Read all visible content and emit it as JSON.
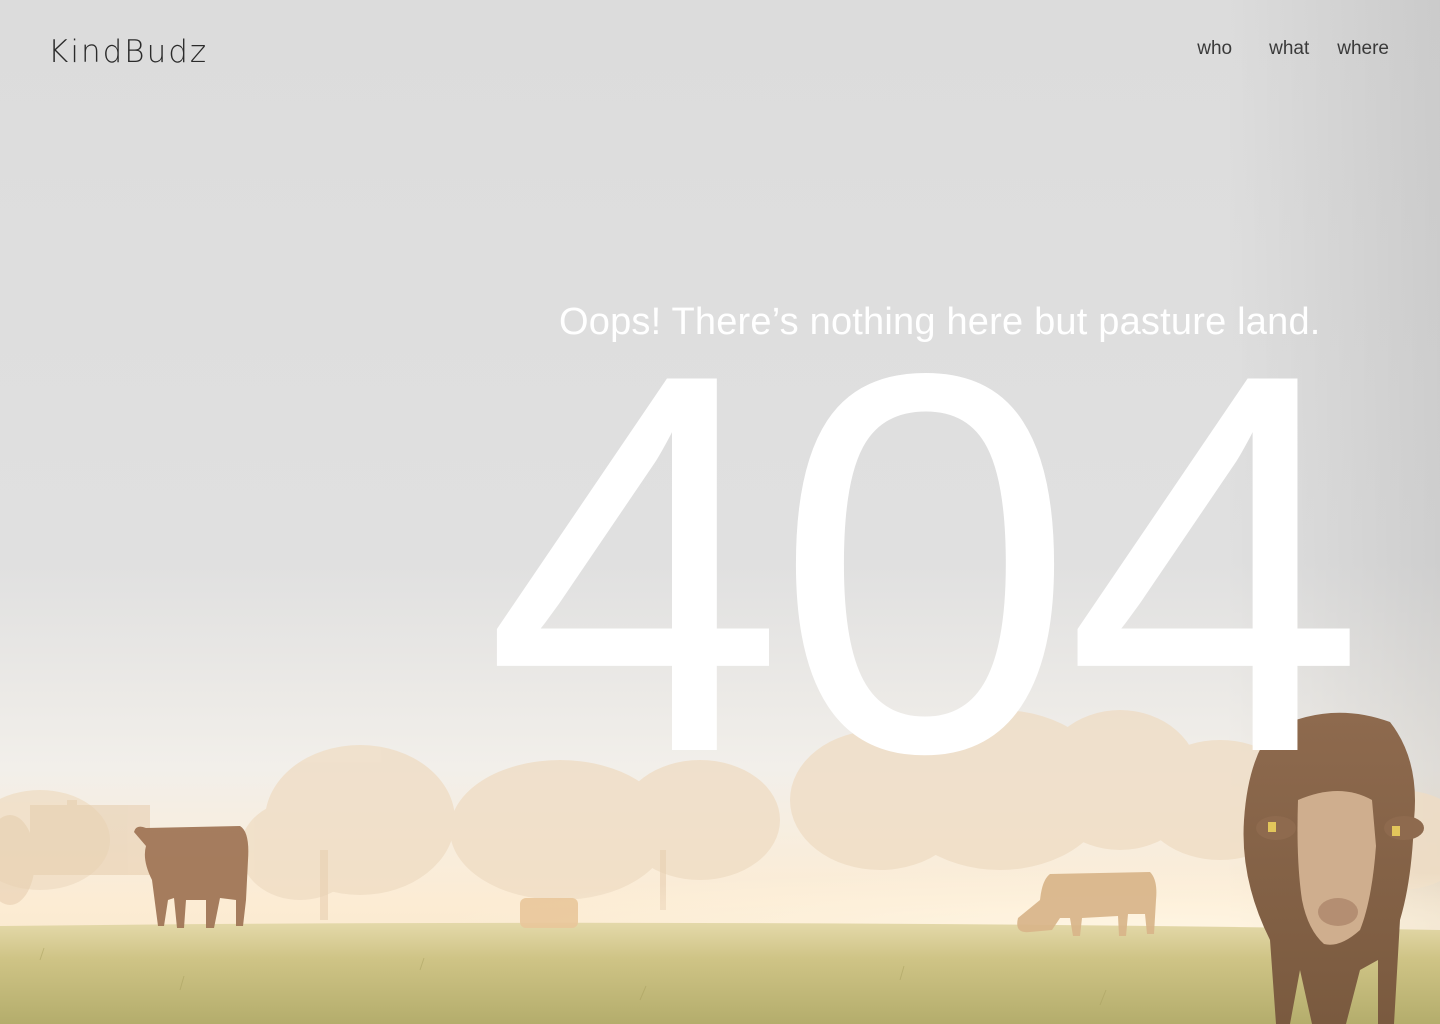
{
  "header": {
    "logo": "KindBudz",
    "nav": [
      {
        "label": "who"
      },
      {
        "label": "what"
      },
      {
        "label": "where"
      }
    ]
  },
  "main": {
    "message": "Oops! There’s nothing here but pasture land.",
    "error_code": "404"
  },
  "colors": {
    "sky": "#dedede",
    "haze": "#fbeedd",
    "grass": "#c9c08a",
    "cow": "#8a6a4e",
    "text_dark": "#2b2b2b",
    "text_light": "#ffffff"
  }
}
